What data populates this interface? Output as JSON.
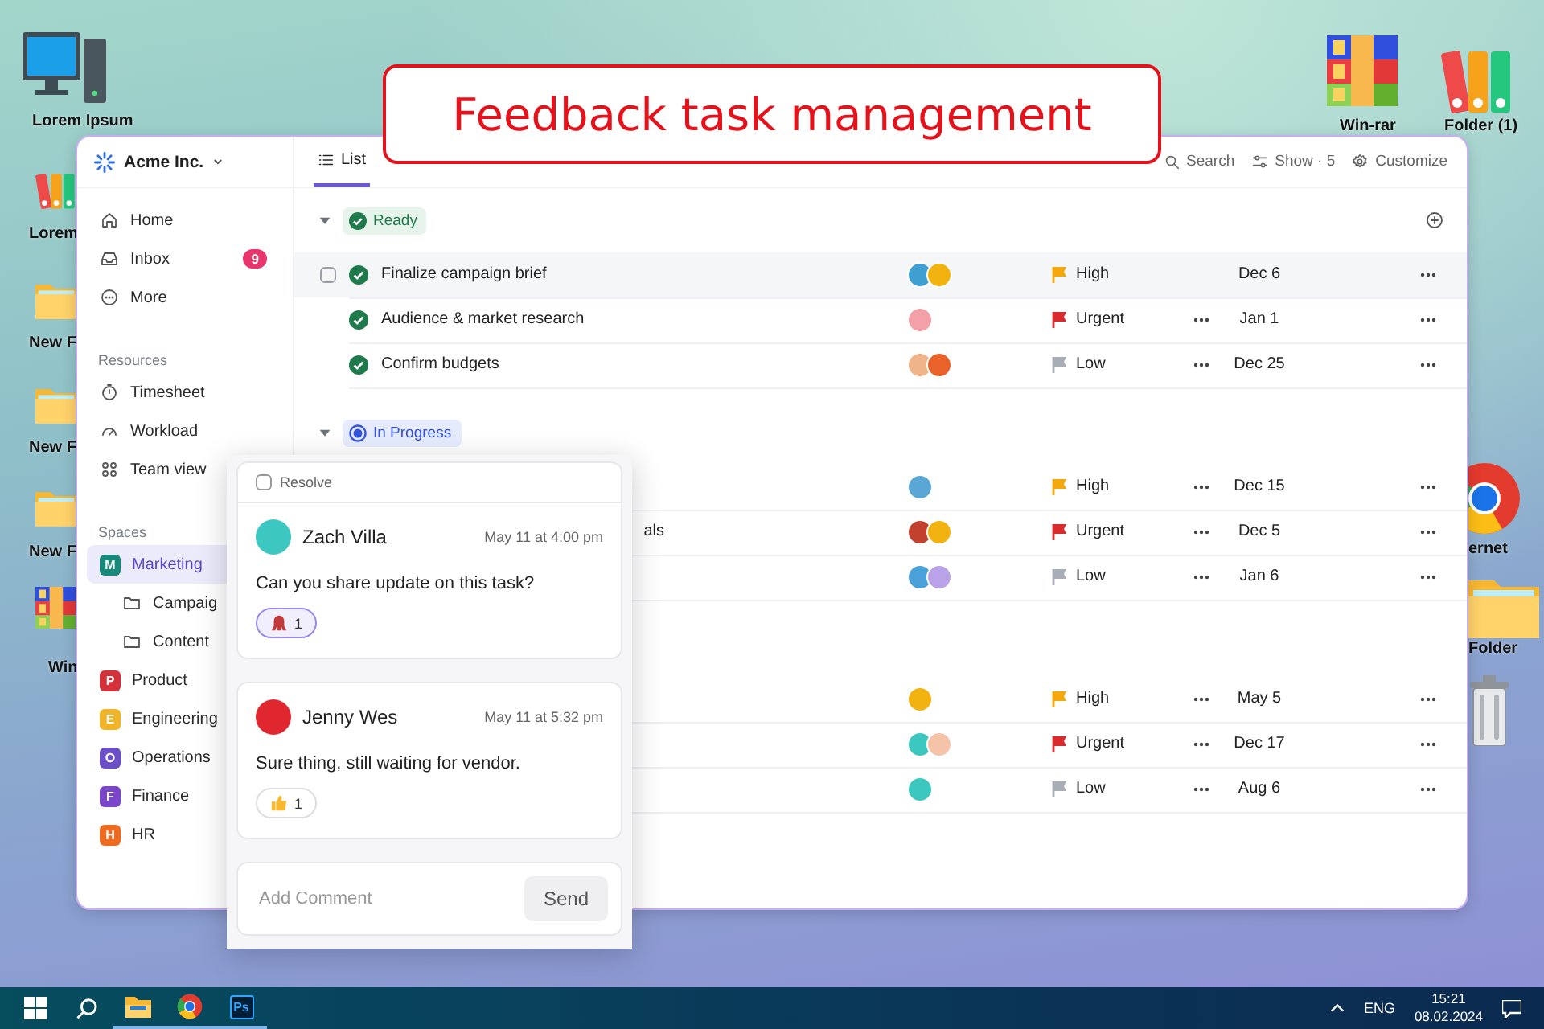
{
  "banner": {
    "title": "Feedback task management"
  },
  "desktop_icons": [
    {
      "kind": "computer",
      "label": "Lorem Ipsum"
    },
    {
      "kind": "binders",
      "label": "Lorem"
    },
    {
      "kind": "folder",
      "label": "New F"
    },
    {
      "kind": "folder",
      "label": "New F"
    },
    {
      "kind": "folder",
      "label": "New F"
    },
    {
      "kind": "archive",
      "label": "Win"
    },
    {
      "kind": "archive",
      "label": "Win-rar"
    },
    {
      "kind": "binders",
      "label": "Folder (1)"
    },
    {
      "kind": "browser",
      "label": "ernet"
    },
    {
      "kind": "folder",
      "label": "Folder"
    },
    {
      "kind": "trash"
    }
  ],
  "workspace": {
    "name": "Acme Inc."
  },
  "sidebar": {
    "items": [
      {
        "label": "Home",
        "selected": false
      },
      {
        "label": "Inbox",
        "badge": "9",
        "selected": false
      },
      {
        "label": "More",
        "selected": false
      }
    ],
    "resources": {
      "title": "Resources",
      "items": [
        {
          "label": "Timesheet",
          "selected": false
        },
        {
          "label": "Workload",
          "selected": false
        },
        {
          "label": "Team view",
          "selected": false
        }
      ]
    },
    "spaces": {
      "title": "Spaces",
      "items": [
        {
          "label": "Marketing",
          "letter": "M",
          "color": "#178a7c",
          "selected": true,
          "children": [
            {
              "label": "Campaig",
              "selected": false
            },
            {
              "label": "Content",
              "selected": false
            }
          ]
        },
        {
          "label": "Product",
          "letter": "P",
          "color": "#d4313a",
          "selected": false
        },
        {
          "label": "Engineering",
          "letter": "E",
          "color": "#f0b429",
          "selected": false
        },
        {
          "label": "Operations",
          "letter": "O",
          "color": "#6b4fc8",
          "selected": false
        },
        {
          "label": "Finance",
          "letter": "F",
          "color": "#7a45c9",
          "selected": false
        },
        {
          "label": "HR",
          "letter": "H",
          "color": "#ee6a1f",
          "selected": false
        }
      ]
    }
  },
  "views": {
    "tabs": [
      {
        "label": "List",
        "selected": true
      }
    ],
    "actions": [
      {
        "label": "Search"
      },
      {
        "label": "Show · 5"
      },
      {
        "label": "Customize"
      }
    ]
  },
  "groups": [
    {
      "status": "Ready",
      "kind": "done",
      "tasks": [
        {
          "name": "Finalize campaign brief",
          "hovered": true,
          "avatars": [
            {
              "color": "#3f9fd0"
            },
            {
              "color": "#f2b20f"
            }
          ],
          "priority": {
            "label": "High",
            "kind": "high"
          },
          "date": "Dec 6"
        },
        {
          "name": "Audience & market research",
          "hovered": false,
          "avatars": [
            {
              "color": "#f3a0a8"
            }
          ],
          "priority": {
            "label": "Urgent",
            "kind": "urgent"
          },
          "date": "Jan 1"
        },
        {
          "name": "Confirm budgets",
          "hovered": false,
          "avatars": [
            {
              "color": "#f0b48a"
            },
            {
              "color": "#e8622a"
            }
          ],
          "priority": {
            "label": "Low",
            "kind": "low"
          },
          "date": "Dec 25"
        }
      ]
    },
    {
      "status": "In Progress",
      "kind": "progress",
      "tasks": [
        {
          "hovered": false,
          "avatars": [
            {
              "color": "#5aa7d6"
            }
          ],
          "priority": {
            "label": "High",
            "kind": "high"
          },
          "date": "Dec 15"
        },
        {
          "name": "als",
          "clipped": true,
          "hovered": false,
          "avatars": [
            {
              "color": "#c2412e"
            },
            {
              "color": "#f2b20f"
            }
          ],
          "priority": {
            "label": "Urgent",
            "kind": "urgent"
          },
          "date": "Dec 5"
        },
        {
          "hovered": false,
          "avatars": [
            {
              "color": "#4aa0d8"
            },
            {
              "color": "#b9a2e8"
            }
          ],
          "priority": {
            "label": "Low",
            "kind": "low"
          },
          "date": "Jan 6"
        }
      ]
    },
    {
      "kind": "hidden",
      "tasks": [
        {
          "hovered": false,
          "avatars": [
            {
              "color": "#f2b20f"
            }
          ],
          "priority": {
            "label": "High",
            "kind": "high"
          },
          "date": "May 5"
        },
        {
          "hovered": false,
          "avatars": [
            {
              "color": "#3cc7c0"
            },
            {
              "color": "#f5c4a8"
            }
          ],
          "priority": {
            "label": "Urgent",
            "kind": "urgent"
          },
          "date": "Dec 17"
        },
        {
          "hovered": false,
          "avatars": [
            {
              "color": "#3cc7c0"
            }
          ],
          "priority": {
            "label": "Low",
            "kind": "low"
          },
          "date": "Aug 6"
        }
      ]
    }
  ],
  "comments": {
    "resolve": {
      "label": "Resolve",
      "checked": false
    },
    "items": [
      {
        "author": "Zach Villa",
        "color": "#3cc7c0",
        "time": "May 11 at 4:00 pm",
        "text": "Can you share update on this task?",
        "reaction": {
          "kind": "creature",
          "count": "1",
          "selected": true
        }
      },
      {
        "author": "Jenny Wes",
        "color": "#e0262f",
        "time": "May 11 at 5:32 pm",
        "text": "Sure thing, still waiting for vendor.",
        "reaction": {
          "kind": "thumbs-up",
          "count": "1",
          "selected": false
        }
      }
    ],
    "input": {
      "placeholder": "Add Comment"
    },
    "send": "Send"
  },
  "taskbar": {
    "apps": [
      {
        "kind": "start",
        "running": false
      },
      {
        "kind": "search",
        "running": false
      },
      {
        "kind": "explorer",
        "running": true
      },
      {
        "kind": "browser",
        "running": true
      },
      {
        "kind": "photoshop",
        "label": "Ps",
        "running": true
      }
    ],
    "language": "ENG",
    "time": "15:21",
    "date": "08.02.2024"
  }
}
